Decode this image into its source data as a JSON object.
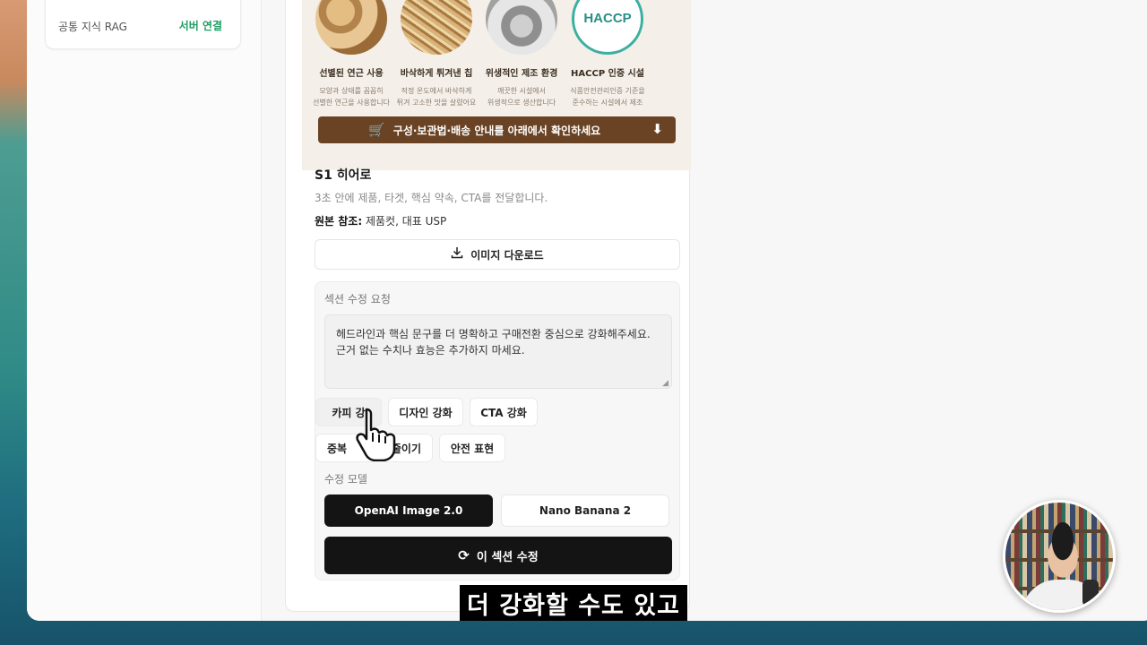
{
  "sidebar": {
    "rag_card": {
      "title": "공통 지식 RAG",
      "status": "서버 연결",
      "status_color": "#1f9d63"
    }
  },
  "banner": {
    "features": [
      {
        "title": "선별된 연근 사용",
        "desc1": "모양과 상태를 꼼꼼히",
        "desc2": "선별한 연근을 사용합니다",
        "icon": "lotus-root-image"
      },
      {
        "title": "바삭하게 튀겨낸 칩",
        "desc1": "적정 온도에서 바삭하게",
        "desc2": "튀겨 고소한 맛을 살렸어요",
        "icon": "fried-chips-image"
      },
      {
        "title": "위생적인 제조 환경",
        "desc1": "깨끗한 시설에서",
        "desc2": "위생적으로 생산합니다",
        "icon": "factory-image"
      },
      {
        "title": "HACCP 인증 시설",
        "desc1": "식품안전관리인증 기준을",
        "desc2": "준수하는 시설에서 제조",
        "icon": "haccp-badge",
        "badge_text": "HACCP"
      }
    ],
    "cta": "구성·보관법·배송 안내를 아래에서 확인하세요",
    "cta_color": "#6a4324"
  },
  "section": {
    "title": "S1 히어로",
    "desc": "3초 안에 제품, 타겟, 핵심 약속, CTA를 전달합니다.",
    "ref_label": "원본 참조:",
    "ref_value": " 제품컷, 대표 USP",
    "download_label": "이미지 다운로드"
  },
  "edit": {
    "label": "섹션 수정 요청",
    "request_text": "헤드라인과 핵심 문구를 더 명확하고 구매전환 중심으로 강화해주세요. 근거 없는 수치나 효능은 추가하지 마세요.",
    "chips": [
      "카피 강화",
      "디자인 강화",
      "CTA 강화",
      "중복 줄이기",
      "안전 표현"
    ],
    "chip1_visible": "카피 강",
    "chip4_visible_left": "중복",
    "chip4_visible_right": "줄이기",
    "model_label": "수정 모델",
    "models": [
      "OpenAI Image 2.0",
      "Nano Banana 2"
    ],
    "selected_model": "OpenAI Image 2.0",
    "submit_label": "이 섹션 수정"
  },
  "video_overlay": {
    "subtitle": "더 강화할 수도 있고"
  }
}
